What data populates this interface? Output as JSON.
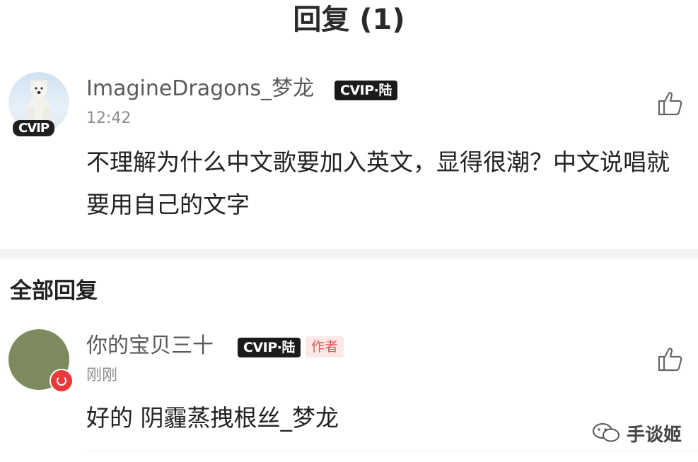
{
  "header": {
    "title": "回复 (1)"
  },
  "main_comment": {
    "username": "ImagineDragons_梦龙",
    "vip_badge": "CVIP·陆",
    "avatar_badge": "CVIP",
    "timestamp": "12:42",
    "text": "不理解为什么中文歌要加入英文，显得很潮？中文说唱就要用自己的文字"
  },
  "section": {
    "title": "全部回复"
  },
  "reply": {
    "username": "你的宝贝三十",
    "vip_badge": "CVIP·陆",
    "author_tag": "作者",
    "timestamp": "刚刚",
    "text": "好的 阴霾蒸拽根丝_梦龙"
  },
  "watermark": {
    "text": "手谈姬"
  },
  "icons": {
    "like": "thumbs-up-icon",
    "wechat": "wechat-icon"
  },
  "colors": {
    "vip_badge_bg": "#1b1b1b",
    "author_tag_bg": "#fde8e8",
    "author_tag_text": "#e25555",
    "reply_avatar": "#7d8a5d",
    "red_mark": "#e83a3a"
  }
}
